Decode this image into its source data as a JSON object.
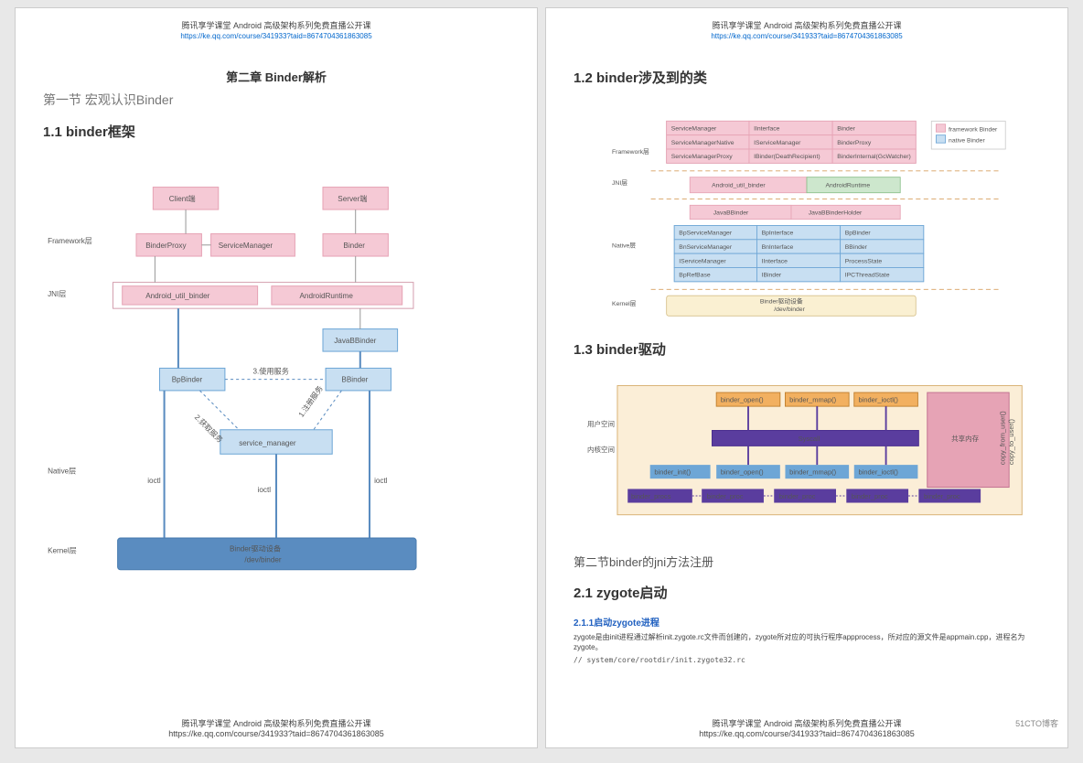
{
  "header": {
    "title": "腾讯享学课堂 Android 高级架构系列免费直播公开课",
    "url": "https://ke.qq.com/course/341933?taid=8674704361863085"
  },
  "chapter": "第二章 Binder解析",
  "section1": "第一节 宏观认识Binder",
  "h11": "1.1 binder框架",
  "h12": "1.2 binder涉及到的类",
  "h13": "1.3 binder驱动",
  "section2": "第二节binder的jni方法注册",
  "h21": "2.1 zygote启动",
  "h211": "2.1.1启动zygote进程",
  "zygote_desc": "zygote是由init进程通过解析init.zygote.rc文件而创建的，zygote所对应的可执行程序appprocess，所对应的源文件是appmain.cpp，进程名为zygote。",
  "zygote_path": "// system/core/rootdir/init.zygote32.rc",
  "d1": {
    "fw": "Framework层",
    "jni": "JNI层",
    "native": "Native层",
    "kernel": "Kernel层",
    "client": "Client端",
    "server": "Server端",
    "bp": "BinderProxy",
    "sm": "ServiceManager",
    "binder": "Binder",
    "aub": "Android_util_binder",
    "art": "AndroidRuntime",
    "jbb": "JavaBBinder",
    "bpb": "BpBinder",
    "bbb": "BBinder",
    "svm": "service_manager",
    "use": "3.使用服务",
    "get": "2.获取服务",
    "reg": "1.注册服务",
    "ioctl": "ioctl",
    "driver_l1": "Binder驱动设备",
    "driver_l2": "/dev/binder"
  },
  "d2": {
    "fw": "Framework层",
    "jni": "JNI层",
    "native": "Native层",
    "kernel": "Kernel层",
    "fwbox": {
      "r1": [
        "ServiceManager",
        "IInterface",
        "Binder"
      ],
      "r2": [
        "ServiceManagerNative",
        "IServiceManager",
        "BinderProxy"
      ],
      "r3": [
        "ServiceManagerProxy",
        "IBinder(DeathRecipient)",
        "BinderInternal(GcWatcher)"
      ]
    },
    "legend": {
      "fw": "framework Binder",
      "nt": "native Binder"
    },
    "jnibox": [
      "Android_util_binder",
      "AndroidRuntime"
    ],
    "extra": [
      "JavaBBinder",
      "JavaBBinderHolder"
    ],
    "nativebox": {
      "r1": [
        "BpServiceManager",
        "BpInterface",
        "BpBinder"
      ],
      "r2": [
        "BnServiceManager",
        "BnInterface",
        "BBinder"
      ],
      "r3": [
        "IServiceManager",
        "IInterface",
        "ProcessState"
      ],
      "r4": [
        "BpRefBase",
        "IBinder",
        "IPCThreadState"
      ]
    },
    "kernel_l1": "Binder驱动设备",
    "kernel_l2": "/dev/binder"
  },
  "d3": {
    "user": "用户空间",
    "kernel": "内核空间",
    "syscall": "Syscall",
    "share": "共享内存",
    "top": [
      "binder_open()",
      "binder_mmap()",
      "binder_ioctl()"
    ],
    "bot": [
      "binder_init()",
      "binder_open()",
      "binder_mmap()",
      "binder_ioctl()"
    ],
    "procs": [
      "binder_procs",
      "binder_proc",
      "binder_proc",
      "binder_proc",
      "binder_proc"
    ],
    "rlabels": [
      "copy_from_user()",
      "copy_to_user()"
    ]
  },
  "watermark": "51CTO博客"
}
